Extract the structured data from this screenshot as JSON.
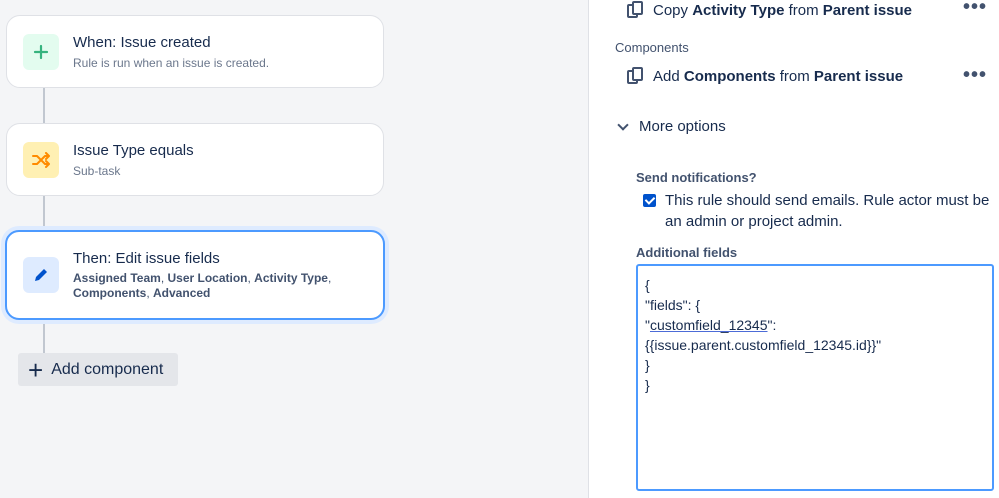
{
  "flow": {
    "trigger": {
      "title": "When: Issue created",
      "subtitle": "Rule is run when an issue is created.",
      "icon": "plus-icon"
    },
    "condition": {
      "title": "Issue Type equals",
      "subtitle": "Sub-task",
      "icon": "shuffle-icon"
    },
    "action": {
      "title": "Then: Edit issue fields",
      "fields": [
        "Assigned Team",
        "User Location",
        "Activity Type",
        "Components",
        "Advanced"
      ],
      "icon": "pencil-icon"
    },
    "add_component": "Add component"
  },
  "panel": {
    "copy_activity": {
      "prefix": "Copy ",
      "field": "Activity Type",
      "middle": " from ",
      "source": "Parent issue"
    },
    "components_label": "Components",
    "add_components": {
      "prefix": "Add ",
      "field": "Components",
      "middle": " from ",
      "source": "Parent issue"
    },
    "more_options": "More options",
    "send_notifications_label": "Send notifications?",
    "send_notifications_text": "This rule should send emails. Rule actor must be an admin or project admin.",
    "send_notifications_checked": true,
    "additional_fields_label": "Additional fields",
    "additional_fields_value": {
      "line1": "{",
      "line2": "\"fields\": {",
      "line3_key": "customfield_12345",
      "line4": "{{issue.parent.customfield_12345.id}}\"",
      "line5": "}",
      "line6": "}"
    }
  },
  "colors": {
    "accent": "#0052cc",
    "focus": "#4c9aff",
    "trigger_bg": "#e3fcef",
    "condition_bg": "#fff0b3"
  }
}
